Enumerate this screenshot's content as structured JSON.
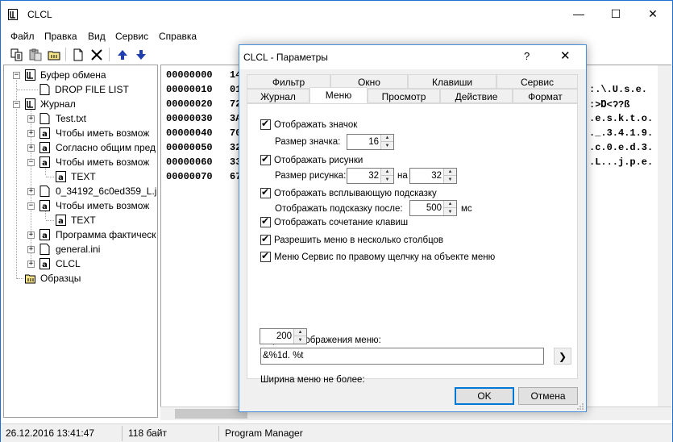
{
  "window": {
    "title": "CLCL",
    "min_glyph": "—",
    "max_glyph": "☐",
    "close_glyph": "✕"
  },
  "menu": {
    "items": [
      "Файл",
      "Правка",
      "Вид",
      "Сервис",
      "Справка"
    ]
  },
  "toolbar": {
    "buttons": [
      "copy-icon",
      "paste-icon",
      "folder-icon",
      "new-icon",
      "delete-icon",
      "arrow-up-icon",
      "arrow-down-icon"
    ]
  },
  "tree": {
    "clipboard": "Буфер обмена",
    "drop_file_list": "DROP FILE LIST",
    "journal": "Журнал",
    "items": [
      "Test.txt",
      "Чтобы иметь возмож",
      "Согласно общим пред",
      "Чтобы иметь возмож",
      "TEXT",
      "0_34192_6c0ed359_L.jpe",
      "Чтобы иметь возмож",
      "TEXT",
      "Программа фактическ",
      "general.ini",
      "CLCL"
    ],
    "templates": "Образцы"
  },
  "hex": {
    "offsets": [
      "00000000",
      "00000010",
      "00000020",
      "00000030",
      "00000040",
      "00000050",
      "00000060",
      "00000070"
    ],
    "first_bytes": [
      "14",
      "01",
      "72",
      "3A",
      "70",
      "32",
      "33",
      "67"
    ],
    "ascii_tail": [
      "",
      ":.\\.U.s.e.",
      ":>Ɒ<ʔ?ß",
      ".e.s.k.t.o.",
      "._.3.4.1.9.",
      ".c.0.e.d.3.",
      ".L...j.p.e.",
      ""
    ]
  },
  "status": {
    "datetime": "26.12.2016 13:41:47",
    "size": "118 байт",
    "window": "Program Manager"
  },
  "dialog": {
    "title": "CLCL - Параметры",
    "help_glyph": "?",
    "close_glyph": "✕",
    "tabs_row1": [
      "Фильтр",
      "Окно",
      "Клавиши",
      "Сервис"
    ],
    "tabs_row2": [
      "Журнал",
      "Меню",
      "Просмотр",
      "Действие",
      "Формат"
    ],
    "active_tab": "Меню",
    "show_icon": {
      "label": "Отображать значок",
      "checked": true
    },
    "icon_size": {
      "label": "Размер значка:",
      "value": "16"
    },
    "show_images": {
      "label": "Отображать рисунки",
      "checked": true
    },
    "image_size": {
      "label": "Размер рисунка:",
      "width": "32",
      "by": "на",
      "height": "32"
    },
    "show_tooltip": {
      "label": "Отображать всплывающую подсказку",
      "checked": true
    },
    "tooltip_delay": {
      "label": "Отображать подсказку после:",
      "value": "500",
      "unit": "мс"
    },
    "show_hotkeys": {
      "label": "Отображать сочетание клавиш",
      "checked": true
    },
    "multi_columns": {
      "label": "Разрешить меню в несколько столбцов",
      "checked": true
    },
    "tools_right_click": {
      "label": "Меню Сервис по правому щелчку на объекте меню",
      "checked": true
    },
    "format": {
      "label": "Формат отображения меню:",
      "value": "&%1d. %t",
      "arrow_glyph": "❯"
    },
    "width": {
      "label": "Ширина меню не более:",
      "value": "200"
    },
    "ok": "OK",
    "cancel": "Отмена"
  }
}
